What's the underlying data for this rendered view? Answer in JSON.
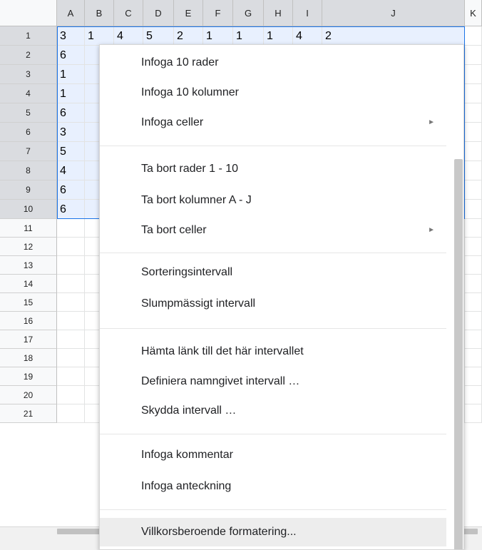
{
  "sheet": {
    "columns": [
      "A",
      "B",
      "C",
      "D",
      "E",
      "F",
      "G",
      "H",
      "I",
      "J",
      "K"
    ],
    "rows": [
      "1",
      "2",
      "3",
      "4",
      "5",
      "6",
      "7",
      "8",
      "9",
      "10",
      "11",
      "12",
      "13",
      "14",
      "15",
      "16",
      "17",
      "18",
      "19",
      "20",
      "21"
    ],
    "column_a_values": [
      "3",
      "6",
      "1",
      "1",
      "6",
      "3",
      "5",
      "4",
      "6",
      "6"
    ],
    "visible_row1_values": [
      "3",
      "1",
      "4",
      "5",
      "2",
      "1",
      "1",
      "1",
      "4",
      "2"
    ],
    "selection": "A1:J10"
  },
  "menu": {
    "items": [
      {
        "label": "Infoga 10 rader",
        "submenu": false
      },
      {
        "label": "Infoga 10 kolumner",
        "submenu": false
      },
      {
        "label": "Infoga celler",
        "submenu": true
      },
      {
        "label": "Ta bort rader 1 - 10",
        "submenu": false
      },
      {
        "label": "Ta bort kolumner A - J",
        "submenu": false
      },
      {
        "label": "Ta bort celler",
        "submenu": true
      },
      {
        "label": "Sorteringsintervall",
        "submenu": false
      },
      {
        "label": "Slumpmässigt intervall",
        "submenu": false
      },
      {
        "label": "Hämta länk till det här intervallet",
        "submenu": false
      },
      {
        "label": "Definiera namngivet intervall …",
        "submenu": false
      },
      {
        "label": "Skydda intervall …",
        "submenu": false
      },
      {
        "label": "Infoga kommentar",
        "submenu": false
      },
      {
        "label": "Infoga anteckning",
        "submenu": false
      },
      {
        "label": "Villkorsberoende formatering...",
        "submenu": false,
        "highlighted": true
      }
    ],
    "submenu_arrow": "►"
  },
  "colors": {
    "selection_fill": "#e8f0fe",
    "selection_border": "#1a73e8",
    "menu_highlight": "#ededed"
  }
}
